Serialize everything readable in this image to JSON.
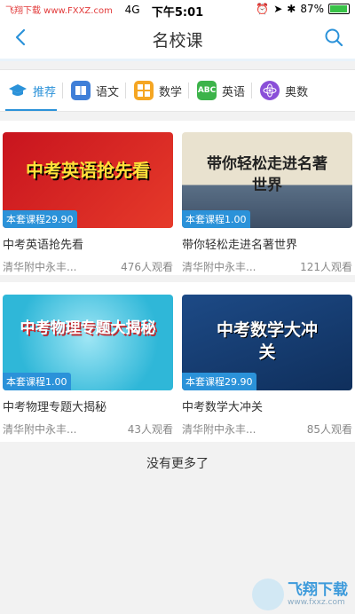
{
  "status": {
    "site": "飞翔下载 www.FXXZ.com",
    "network": "4G",
    "time": "下午5:01",
    "battery": "87%",
    "battery_level": 0.87
  },
  "header": {
    "title": "名校课"
  },
  "tabs": [
    {
      "label": "推荐",
      "active": true,
      "icon": "cap-icon"
    },
    {
      "label": "语文",
      "icon": "book-icon"
    },
    {
      "label": "数学",
      "icon": "math-icon"
    },
    {
      "label": "英语",
      "icon": "abc-icon",
      "icon_text": "ABC"
    },
    {
      "label": "奥数",
      "icon": "atom-icon"
    }
  ],
  "courses": [
    {
      "thumb_text": "中考英语抢先看",
      "price": "本套课程29.90",
      "title": "中考英语抢先看",
      "teacher": "清华附中永丰...",
      "views": "476人观看"
    },
    {
      "thumb_text": "带你轻松走进名著世界",
      "price": "本套课程1.00",
      "title": "带你轻松走进名著世界",
      "teacher": "清华附中永丰...",
      "views": "121人观看"
    },
    {
      "thumb_text": "中考物理专题大揭秘",
      "price": "本套课程1.00",
      "title": "中考物理专题大揭秘",
      "teacher": "清华附中永丰...",
      "views": "43人观看"
    },
    {
      "thumb_text": "中考数学大冲关",
      "price": "本套课程29.90",
      "title": "中考数学大冲关",
      "teacher": "清华附中永丰...",
      "views": "85人观看"
    }
  ],
  "footer": {
    "no_more": "没有更多了"
  },
  "watermark": {
    "brand": "飞翔下载",
    "url": "www.fxxz.com"
  }
}
